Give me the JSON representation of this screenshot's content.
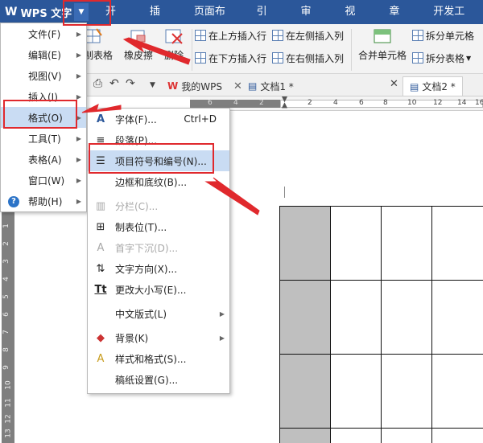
{
  "app": {
    "title": "WPS 文字",
    "logo": "W"
  },
  "ribbon_tabs": [
    "开始",
    "插入",
    "页面布局",
    "引用",
    "审阅",
    "视图",
    "章节",
    "开发工具"
  ],
  "ribbon": {
    "draw_table": "绘制表格",
    "eraser": "橡皮擦",
    "delete": "删除",
    "insert_above": "在上方插入行",
    "insert_below": "在下方插入行",
    "insert_left": "在左侧插入列",
    "insert_right": "在右侧插入列",
    "merge_cells": "合并单元格",
    "split_cells": "拆分单元格",
    "split_table": "拆分表格"
  },
  "doc_tabs": [
    {
      "label": "我的WPS"
    },
    {
      "label": "文档1 *"
    },
    {
      "label": "文档2 *"
    }
  ],
  "ruler": {
    "top_numbers": [
      "6",
      "4",
      "2",
      "2",
      "4",
      "6",
      "8",
      "10",
      "12",
      "14",
      "16"
    ],
    "side_numbers": [
      "1",
      "2",
      "3",
      "4",
      "5",
      "6",
      "7",
      "8",
      "9",
      "10",
      "11",
      "12",
      "13",
      "14"
    ]
  },
  "main_menu": [
    {
      "label": "文件(F)"
    },
    {
      "label": "编辑(E)"
    },
    {
      "label": "视图(V)"
    },
    {
      "label": "插入(I)"
    },
    {
      "label": "格式(O)"
    },
    {
      "label": "工具(T)"
    },
    {
      "label": "表格(A)"
    },
    {
      "label": "窗口(W)"
    },
    {
      "label": "帮助(H)"
    }
  ],
  "format_menu": [
    {
      "label": "字体(F)...",
      "shortcut": "Ctrl+D",
      "icon": "font-icon"
    },
    {
      "label": "段落(P)...",
      "shortcut": "",
      "icon": "paragraph-icon"
    },
    {
      "label": "项目符号和编号(N)...",
      "shortcut": "",
      "icon": "bullet-list-icon"
    },
    {
      "label": "边框和底纹(B)...",
      "shortcut": "",
      "icon": ""
    },
    {
      "label": "分栏(C)...",
      "shortcut": "",
      "icon": "columns-icon"
    },
    {
      "label": "制表位(T)...",
      "shortcut": "",
      "icon": "tab-stops-icon"
    },
    {
      "label": "首字下沉(D)...",
      "shortcut": "",
      "icon": "drop-cap-icon"
    },
    {
      "label": "文字方向(X)...",
      "shortcut": "",
      "icon": "text-direction-icon"
    },
    {
      "label": "更改大小写(E)...",
      "shortcut": "",
      "icon": "change-case-icon"
    },
    {
      "label": "中文版式(L)",
      "shortcut": "",
      "icon": ""
    },
    {
      "label": "背景(K)",
      "shortcut": "",
      "icon": "background-icon"
    },
    {
      "label": "样式和格式(S)...",
      "shortcut": "",
      "icon": "styles-icon"
    },
    {
      "label": "稿纸设置(G)...",
      "shortcut": "",
      "icon": ""
    }
  ],
  "colors": {
    "ribbon_blue": "#2b579a",
    "highlight": "#c9dcf3",
    "annotation_red": "#e0292d",
    "gray_cell": "#bfbfbf"
  }
}
